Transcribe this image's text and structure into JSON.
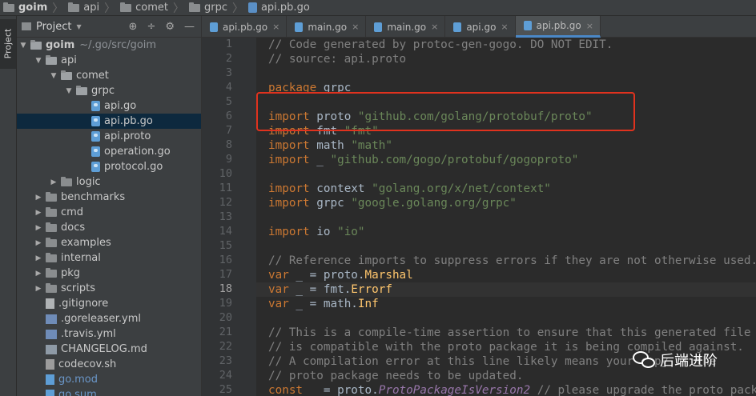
{
  "breadcrumb": [
    "goim",
    "api",
    "comet",
    "grpc",
    "api.pb.go"
  ],
  "toolstrip": {
    "project_tab": "Project"
  },
  "project_panel": {
    "title": "Project",
    "tools": [
      "⊕",
      "÷",
      "⚙",
      "—"
    ]
  },
  "tree": [
    {
      "label": "goim",
      "note": "~/.go/src/goim",
      "kind": "folder",
      "depth": 0,
      "expanded": true,
      "bold": true
    },
    {
      "label": "api",
      "kind": "folder",
      "depth": 1,
      "expanded": true
    },
    {
      "label": "comet",
      "kind": "folder",
      "depth": 2,
      "expanded": true
    },
    {
      "label": "grpc",
      "kind": "folder",
      "depth": 3,
      "expanded": true
    },
    {
      "label": "api.go",
      "kind": "go",
      "depth": 4
    },
    {
      "label": "api.pb.go",
      "kind": "go",
      "depth": 4,
      "selected": true
    },
    {
      "label": "api.proto",
      "kind": "go",
      "depth": 4
    },
    {
      "label": "operation.go",
      "kind": "go",
      "depth": 4
    },
    {
      "label": "protocol.go",
      "kind": "go",
      "depth": 4
    },
    {
      "label": "logic",
      "kind": "folder",
      "depth": 2,
      "expanded": false
    },
    {
      "label": "benchmarks",
      "kind": "folder",
      "depth": 1,
      "expanded": false
    },
    {
      "label": "cmd",
      "kind": "folder",
      "depth": 1,
      "expanded": false
    },
    {
      "label": "docs",
      "kind": "folder",
      "depth": 1,
      "expanded": false
    },
    {
      "label": "examples",
      "kind": "folder",
      "depth": 1,
      "expanded": false
    },
    {
      "label": "internal",
      "kind": "folder",
      "depth": 1,
      "expanded": false
    },
    {
      "label": "pkg",
      "kind": "folder",
      "depth": 1,
      "expanded": false
    },
    {
      "label": "scripts",
      "kind": "folder",
      "depth": 1,
      "expanded": false
    },
    {
      "label": ".gitignore",
      "kind": "file",
      "depth": 1
    },
    {
      "label": ".goreleaser.yml",
      "kind": "yml",
      "depth": 1
    },
    {
      "label": ".travis.yml",
      "kind": "yml",
      "depth": 1
    },
    {
      "label": "CHANGELOG.md",
      "kind": "md",
      "depth": 1
    },
    {
      "label": "codecov.sh",
      "kind": "sh",
      "depth": 1
    },
    {
      "label": "go.mod",
      "kind": "mod",
      "depth": 1,
      "blue": true
    },
    {
      "label": "go.sum",
      "kind": "mod",
      "depth": 1,
      "blue": true
    }
  ],
  "tabs": [
    {
      "label": "api.pb.go",
      "active": false
    },
    {
      "label": "main.go",
      "active": false
    },
    {
      "label": "main.go",
      "active": false
    },
    {
      "label": "api.go",
      "active": false
    },
    {
      "label": "api.pb.go",
      "active": true
    }
  ],
  "editor": {
    "current_line": 18,
    "lines": [
      [
        [
          "cmt",
          "// Code generated by protoc-gen-gogo. DO NOT EDIT."
        ]
      ],
      [
        [
          "cmt",
          "// source: api.proto"
        ]
      ],
      [],
      [
        [
          "kw",
          "package"
        ],
        [
          "",
          " grpc"
        ]
      ],
      [],
      [
        [
          "kw",
          "import"
        ],
        [
          "",
          " proto "
        ],
        [
          "str",
          "\"github.com/golang/protobuf/proto\""
        ]
      ],
      [
        [
          "kw",
          "import"
        ],
        [
          "",
          " fmt "
        ],
        [
          "str",
          "\"fmt\""
        ]
      ],
      [
        [
          "kw",
          "import"
        ],
        [
          "",
          " math "
        ],
        [
          "str",
          "\"math\""
        ]
      ],
      [
        [
          "kw",
          "import"
        ],
        [
          "",
          " _ "
        ],
        [
          "str",
          "\"github.com/gogo/protobuf/gogoproto\""
        ]
      ],
      [],
      [
        [
          "kw",
          "import"
        ],
        [
          "",
          " context "
        ],
        [
          "str",
          "\"golang.org/x/net/context\""
        ]
      ],
      [
        [
          "kw",
          "import"
        ],
        [
          "",
          " grpc "
        ],
        [
          "str",
          "\"google.golang.org/grpc\""
        ]
      ],
      [],
      [
        [
          "kw",
          "import"
        ],
        [
          "",
          " io "
        ],
        [
          "str",
          "\"io\""
        ]
      ],
      [],
      [
        [
          "cmt",
          "// Reference imports to suppress errors if they are not otherwise used."
        ]
      ],
      [
        [
          "kw",
          "var"
        ],
        [
          "",
          " _ = proto."
        ],
        [
          "fn",
          "Marshal"
        ]
      ],
      [
        [
          "kw",
          "var"
        ],
        [
          "",
          " _ = fmt."
        ],
        [
          "fn",
          "Errorf"
        ]
      ],
      [
        [
          "kw",
          "var"
        ],
        [
          "",
          " _ = math."
        ],
        [
          "fn",
          "Inf"
        ]
      ],
      [],
      [
        [
          "cmt",
          "// This is a compile-time assertion to ensure that this generated file"
        ]
      ],
      [
        [
          "cmt",
          "// is compatible with the proto package it is being compiled against."
        ]
      ],
      [
        [
          "cmt",
          "// A compilation error at this line likely means your copy of the"
        ]
      ],
      [
        [
          "cmt",
          "// proto package needs to be updated."
        ]
      ],
      [
        [
          "kw",
          "const"
        ],
        [
          "",
          " _ = proto."
        ],
        [
          "it",
          "ProtoPackageIsVersion2"
        ],
        [
          "cmt",
          " // please upgrade the proto package"
        ]
      ]
    ]
  },
  "watermark": {
    "text": "后端进阶"
  }
}
